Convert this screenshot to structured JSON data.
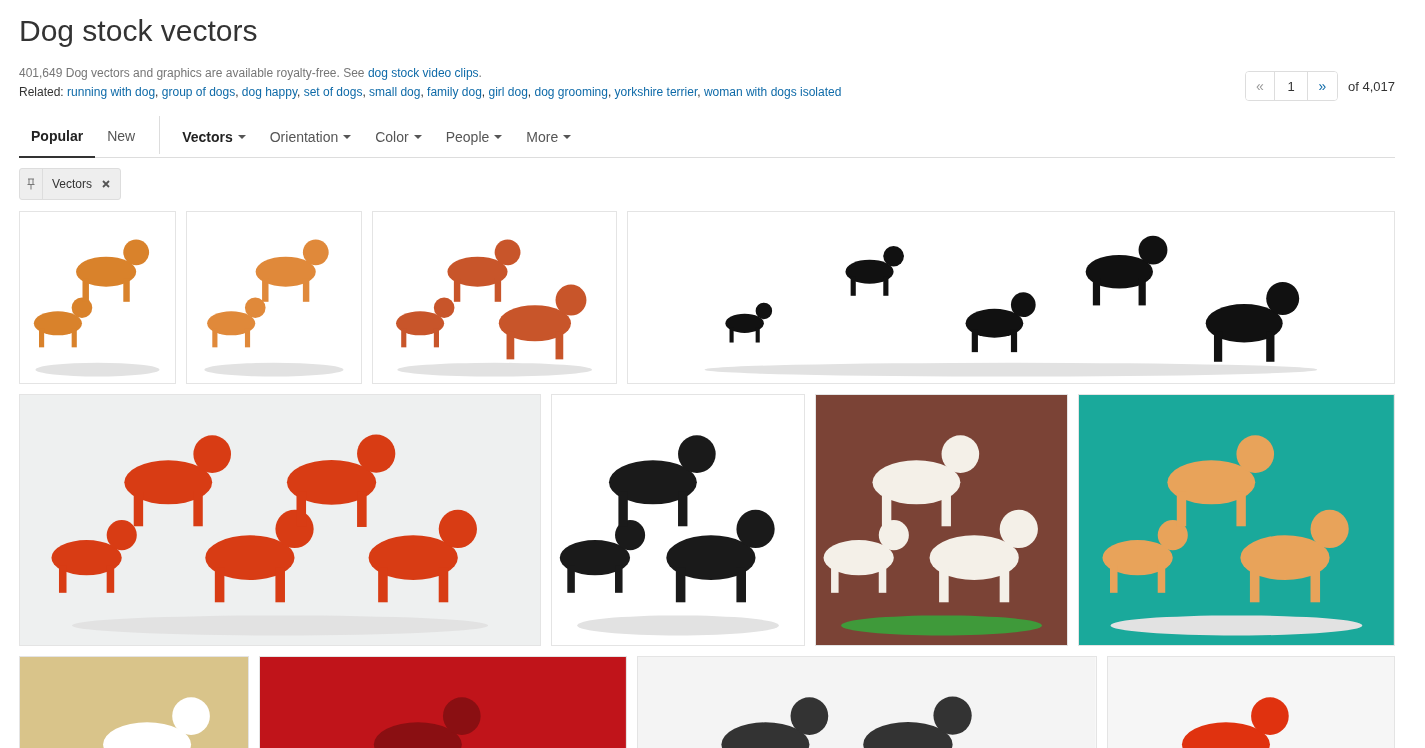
{
  "title": "Dog stock vectors",
  "summary": {
    "text": "401,649 Dog vectors and graphics are available royalty-free. See ",
    "link": "dog stock video clips",
    "end": "."
  },
  "related": {
    "label": "Related:",
    "separator": ",",
    "links": [
      "running with dog",
      "group of dogs",
      "dog happy",
      "set of dogs",
      "small dog",
      "family dog",
      "girl dog",
      "dog grooming",
      "yorkshire terrier",
      "woman with dogs isolated"
    ]
  },
  "pager": {
    "prev": "«",
    "page": "1",
    "next": "»",
    "total": "of 4,017"
  },
  "tabs": [
    {
      "label": "Popular",
      "selected": true
    },
    {
      "label": "New",
      "selected": false
    }
  ],
  "filters": [
    {
      "label": "Vectors",
      "active": true
    },
    {
      "label": "Orientation",
      "active": false
    },
    {
      "label": "Color",
      "active": false
    },
    {
      "label": "People",
      "active": false
    },
    {
      "label": "More",
      "active": false
    }
  ],
  "chips": [
    {
      "label": "Vectors",
      "pinned": true
    }
  ]
}
